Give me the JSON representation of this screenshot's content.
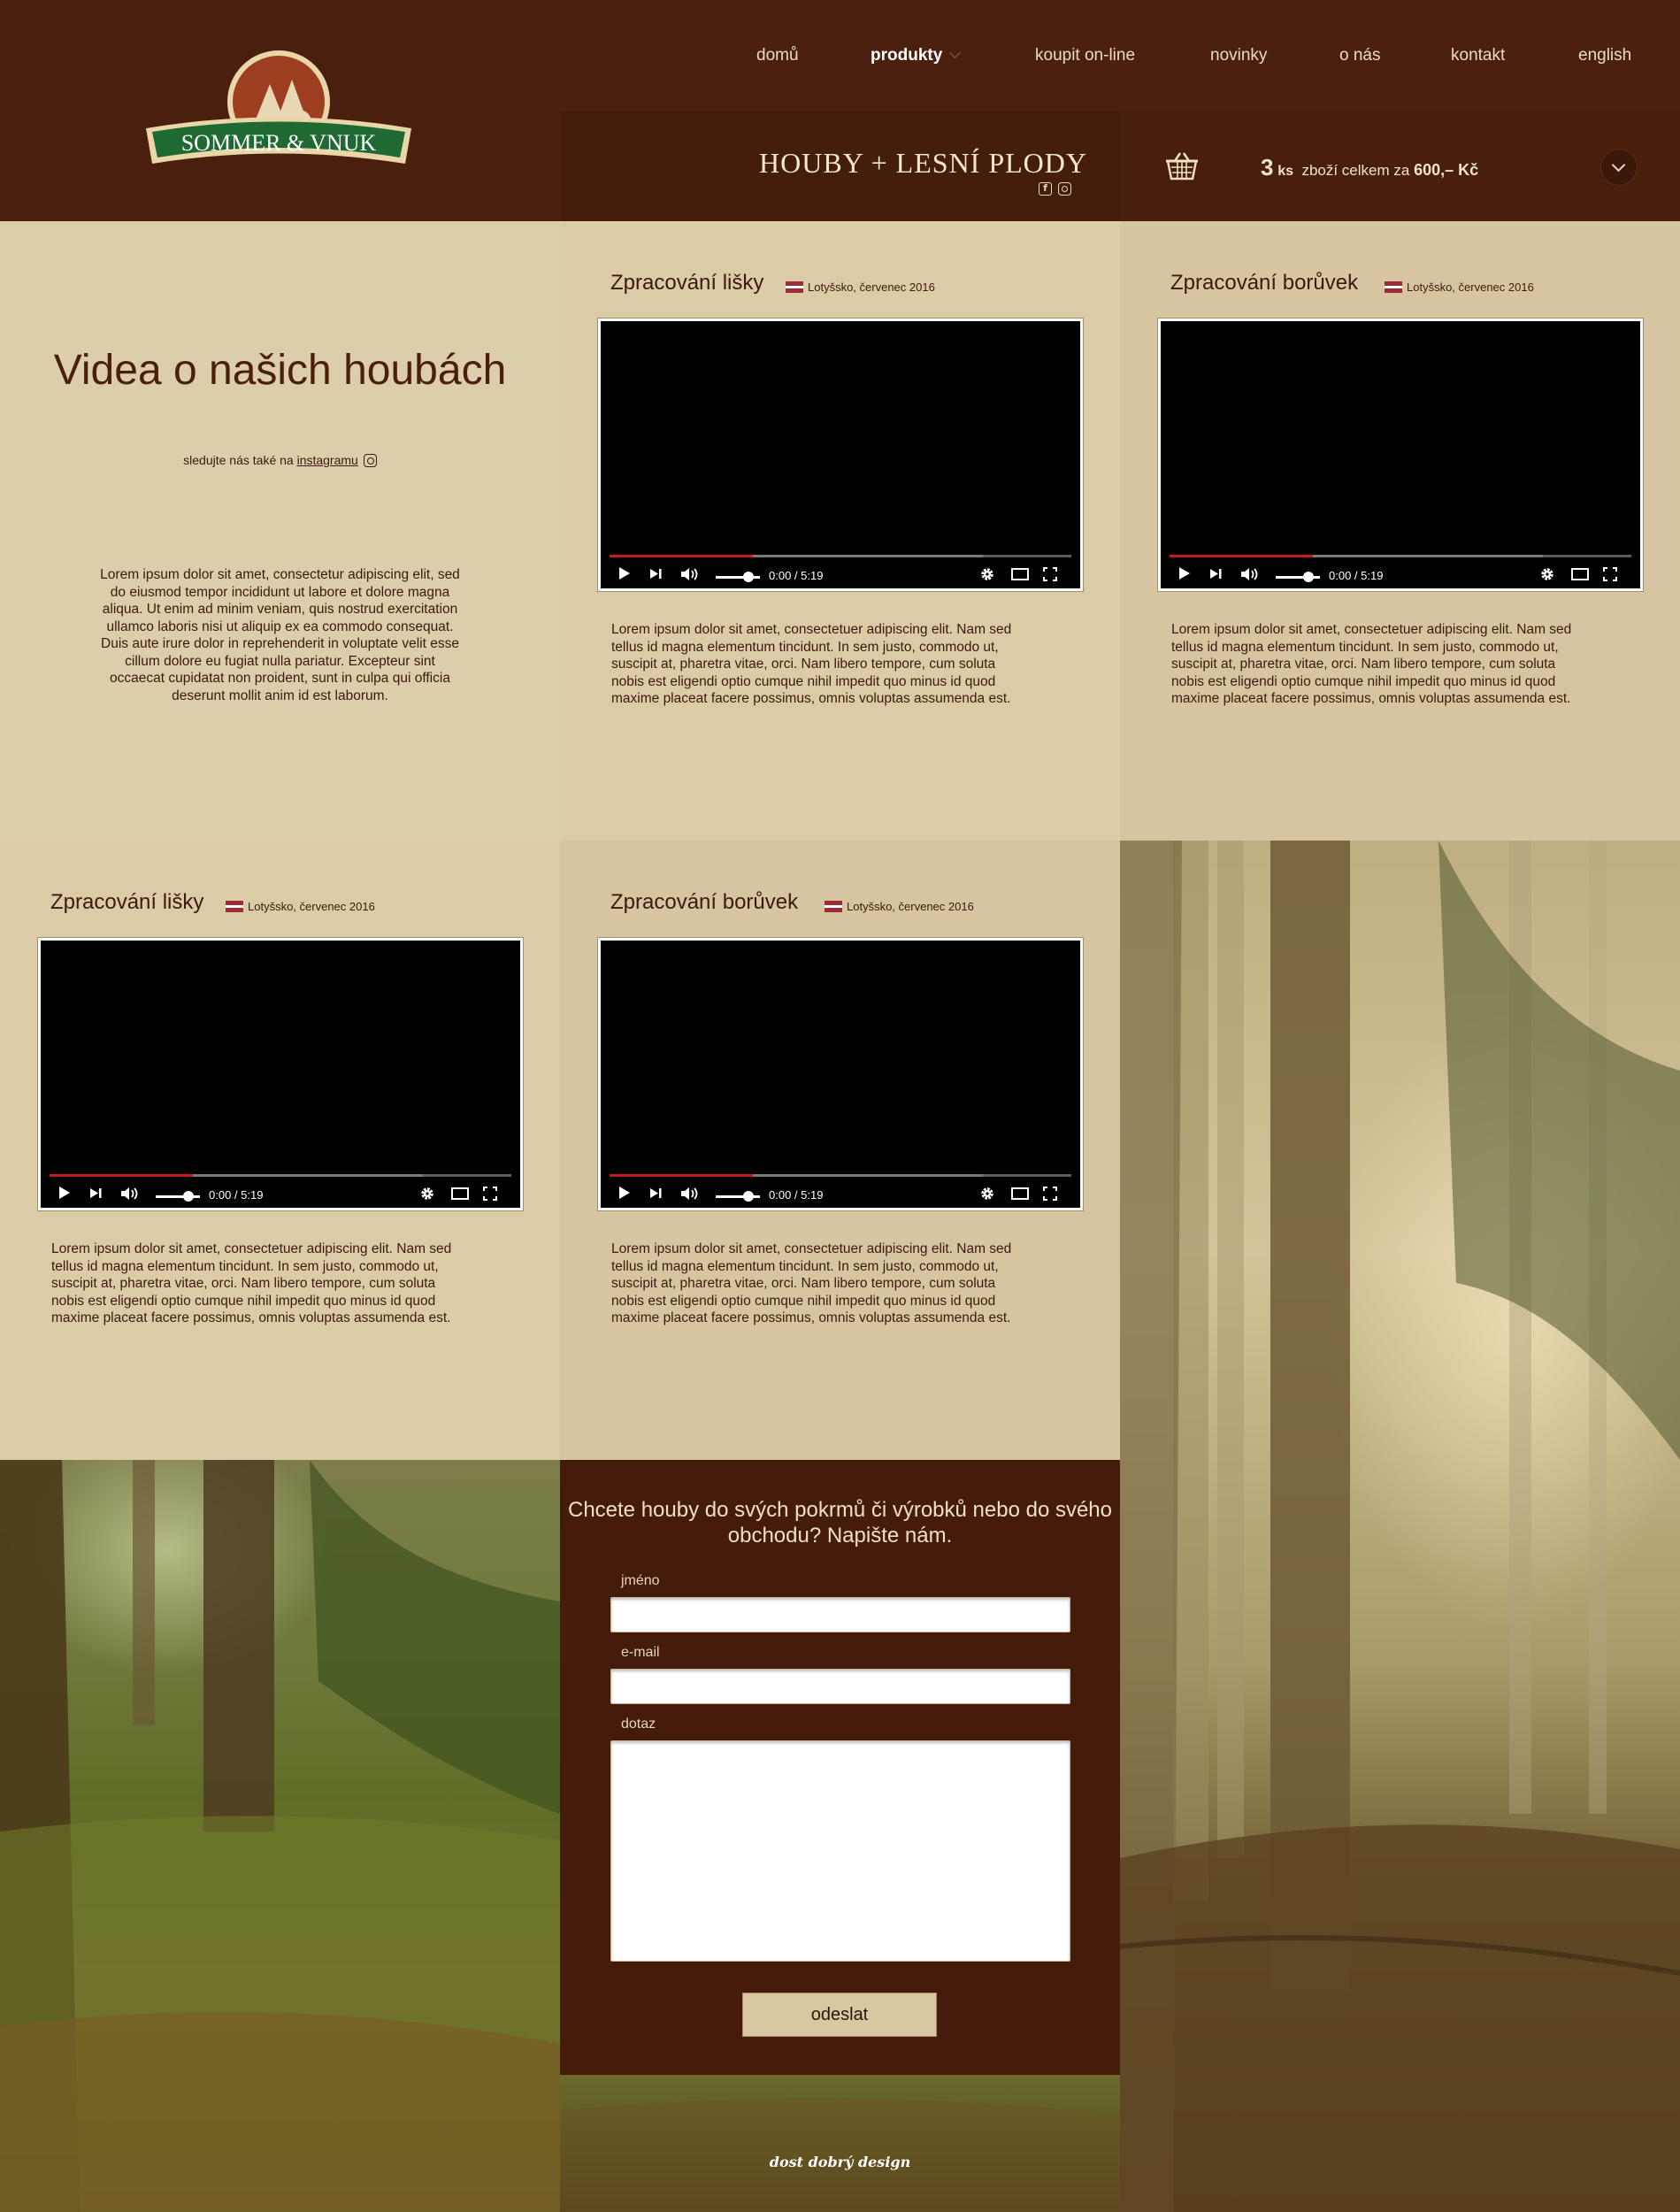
{
  "brand": {
    "name": "SOMMER & VNUK"
  },
  "nav": {
    "items": [
      {
        "label": "domů"
      },
      {
        "label": "produkty"
      },
      {
        "label": "koupit on-line"
      },
      {
        "label": "novinky"
      },
      {
        "label": "o nás"
      },
      {
        "label": "kontakt"
      },
      {
        "label": "english"
      }
    ]
  },
  "category": {
    "title": "HOUBY + LESNÍ PLODY"
  },
  "cart": {
    "count": "3",
    "unit": "ks",
    "text": "zboží celkem za",
    "price": "600,– Kč"
  },
  "intro": {
    "title": "Videa o našich houbách",
    "follow_prefix": "sledujte nás také na",
    "follow_link": "instagramu",
    "text": "Lorem ipsum dolor sit amet, consectetur adipiscing elit, sed do eiusmod tempor incididunt ut labore et dolore magna aliqua. Ut enim ad minim veniam, quis nostrud exercitation ullamco laboris nisi ut aliquip ex ea commodo consequat. Duis aute irure dolor in reprehenderit in voluptate velit esse cillum dolore eu fugiat nulla pariatur. Excepteur sint occaecat cupidatat non proident, sunt in culpa qui officia deserunt mollit anim id est laborum."
  },
  "videos": [
    {
      "title": "Zpracování lišky",
      "meta": "Lotyšsko, červenec 2016",
      "time": "0:00 / 5:19",
      "desc": "Lorem ipsum dolor sit amet, consectetuer adipiscing elit. Nam sed tellus id magna elementum tincidunt. In sem justo, commodo ut, suscipit at, pharetra vitae, orci. Nam libero tempore, cum soluta nobis est eligendi optio cumque nihil impedit quo minus id quod maxime placeat facere possimus, omnis voluptas assumenda est."
    },
    {
      "title": "Zpracování borůvek",
      "meta": "Lotyšsko, červenec 2016",
      "time": "0:00 / 5:19",
      "desc": "Lorem ipsum dolor sit amet, consectetuer adipiscing elit. Nam sed tellus id magna elementum tincidunt. In sem justo, commodo ut, suscipit at, pharetra vitae, orci. Nam libero tempore, cum soluta nobis est eligendi optio cumque nihil impedit quo minus id quod maxime placeat facere possimus, omnis voluptas assumenda est."
    },
    {
      "title": "Zpracování lišky",
      "meta": "Lotyšsko, červenec 2016",
      "time": "0:00 / 5:19",
      "desc": "Lorem ipsum dolor sit amet, consectetuer adipiscing elit. Nam sed tellus id magna elementum tincidunt. In sem justo, commodo ut, suscipit at, pharetra vitae, orci. Nam libero tempore, cum soluta nobis est eligendi optio cumque nihil impedit quo minus id quod maxime placeat facere possimus, omnis voluptas assumenda est."
    },
    {
      "title": "Zpracování borůvek",
      "meta": "Lotyšsko, červenec 2016",
      "time": "0:00 / 5:19",
      "desc": "Lorem ipsum dolor sit amet, consectetuer adipiscing elit. Nam sed tellus id magna elementum tincidunt. In sem justo, commodo ut, suscipit at, pharetra vitae, orci. Nam libero tempore, cum soluta nobis est eligendi optio cumque nihil impedit quo minus id quod maxime placeat facere possimus, omnis voluptas assumenda est."
    }
  ],
  "contact": {
    "title": "Chcete houby do svých pokrmů či výrobků nebo do svého obchodu? Napište nám.",
    "name_label": "jméno",
    "email_label": "e-mail",
    "query_label": "dotaz",
    "submit_label": "odeslat"
  },
  "footer": {
    "credit": "dost dobrý design"
  },
  "colors": {
    "header_dark": "#4a1f0d",
    "beige": "#d6c7a3",
    "beige_light": "#dccdab",
    "accent_red": "#c41b1b"
  }
}
